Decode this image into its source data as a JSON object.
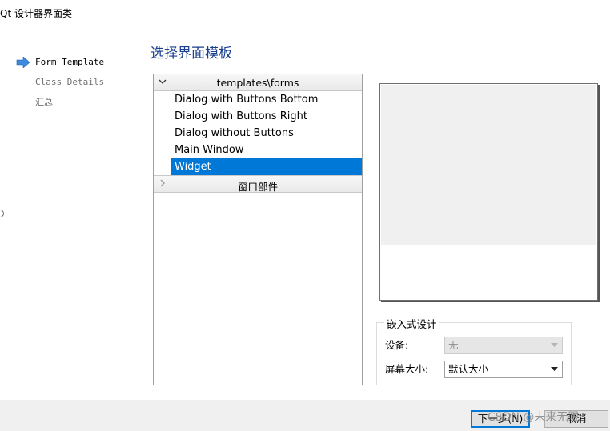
{
  "window": {
    "title": "Qt 设计器界面类"
  },
  "steps": {
    "items": [
      {
        "label": "Form Template",
        "state": "current"
      },
      {
        "label": "Class Details",
        "state": "pending"
      },
      {
        "label": "汇总",
        "state": "pending"
      }
    ]
  },
  "page": {
    "title": "选择界面模板"
  },
  "tree": {
    "groups": [
      {
        "label": "templates\\forms",
        "expanded": true,
        "items": [
          "Dialog with Buttons Bottom",
          "Dialog with Buttons Right",
          "Dialog without Buttons",
          "Main Window",
          "Widget"
        ],
        "selected": "Widget"
      },
      {
        "label": "窗口部件",
        "expanded": false
      }
    ]
  },
  "embedded": {
    "legend": "嵌入式设计",
    "device_label": "设备:",
    "device_value": "无",
    "screen_label": "屏幕大小:",
    "screen_value": "默认大小"
  },
  "buttons": {
    "next": "下一步(N)",
    "cancel": "取消"
  },
  "watermark": "CSDN @未来无限",
  "colors": {
    "accent": "#0078d7",
    "title": "#1a3f8f",
    "current_arrow": "#3c8be0"
  }
}
